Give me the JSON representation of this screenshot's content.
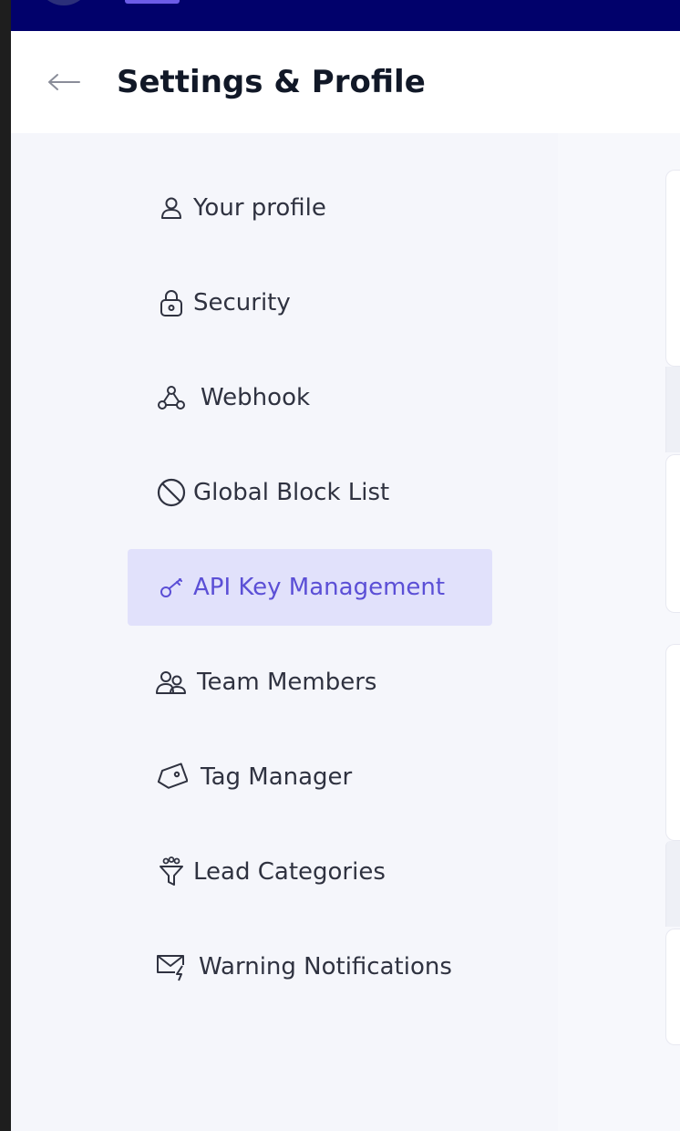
{
  "header": {
    "title": "Settings & Profile",
    "back_icon": "arrow-left-icon"
  },
  "sidebar": {
    "items": [
      {
        "label": "Your profile",
        "icon": "user-icon",
        "active": false
      },
      {
        "label": "Security",
        "icon": "lock-icon",
        "active": false
      },
      {
        "label": "Webhook",
        "icon": "webhook-icon",
        "active": false
      },
      {
        "label": "Global Block List",
        "icon": "block-icon",
        "active": false
      },
      {
        "label": "API Key Management",
        "icon": "key-icon",
        "active": true
      },
      {
        "label": "Team Members",
        "icon": "users-icon",
        "active": false
      },
      {
        "label": "Tag Manager",
        "icon": "tag-icon",
        "active": false
      },
      {
        "label": "Lead Categories",
        "icon": "funnel-icon",
        "active": false
      },
      {
        "label": "Warning Notifications",
        "icon": "mail-alert-icon",
        "active": false
      }
    ]
  },
  "colors": {
    "topbar": "#01016b",
    "active_bg": "#e1e1fb",
    "active_text": "#5b4fd6",
    "text": "#2f3240",
    "background": "#f5f6fb"
  }
}
